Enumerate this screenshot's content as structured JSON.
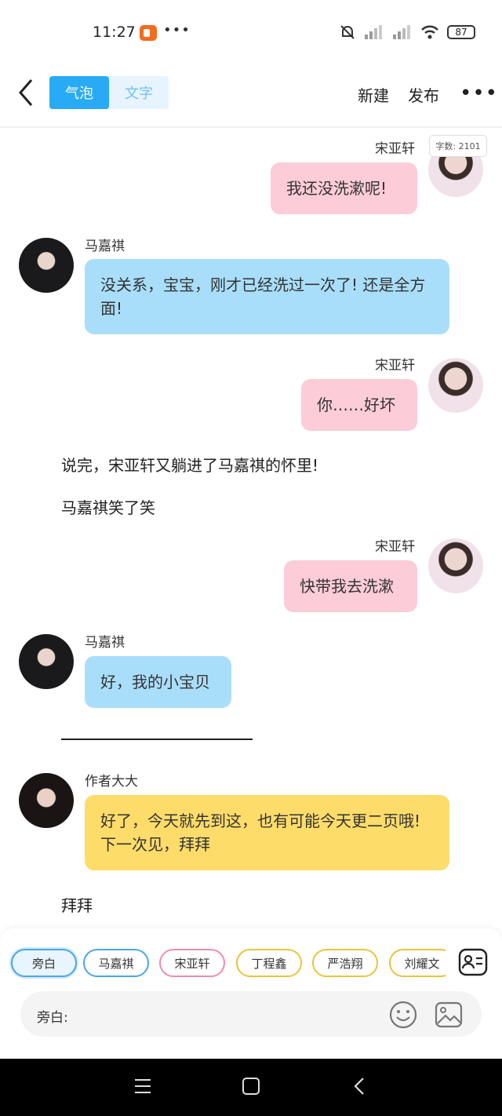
{
  "status": {
    "time": "11:27",
    "battery": "87"
  },
  "header": {
    "tab_bubble": "气泡",
    "tab_text": "文字",
    "new_label": "新建",
    "publish_label": "发布"
  },
  "word_count": "字数: 2101",
  "messages": [
    {
      "type": "right",
      "name": "宋亚轩",
      "text": "我还没洗漱呢!"
    },
    {
      "type": "left",
      "name": "马嘉祺",
      "text": "没关系，宝宝，刚才已经洗过一次了! 还是全方面!"
    },
    {
      "type": "right",
      "name": "宋亚轩",
      "text": "你……好坏"
    },
    {
      "type": "narration",
      "text": "说完，宋亚轩又躺进了马嘉祺的怀里!"
    },
    {
      "type": "narration",
      "text": "马嘉祺笑了笑"
    },
    {
      "type": "right",
      "name": "宋亚轩",
      "text": "快带我去洗漱"
    },
    {
      "type": "left",
      "name": "马嘉祺",
      "text": "好，我的小宝贝"
    },
    {
      "type": "left",
      "name": "作者大大",
      "text": "好了，今天就先到这，也有可能今天更二页哦! 下一次见，拜拜"
    },
    {
      "type": "narration",
      "text": "拜拜"
    }
  ],
  "roles": [
    "旁白",
    "马嘉祺",
    "宋亚轩",
    "丁程鑫",
    "严浩翔",
    "刘耀文"
  ],
  "input": {
    "label": "旁白:"
  },
  "colors": {
    "accent": "#29aaf4",
    "pink_bubble": "#fcccd8",
    "blue_bubble": "#a9defa",
    "yellow_bubble": "#fedc6a"
  }
}
